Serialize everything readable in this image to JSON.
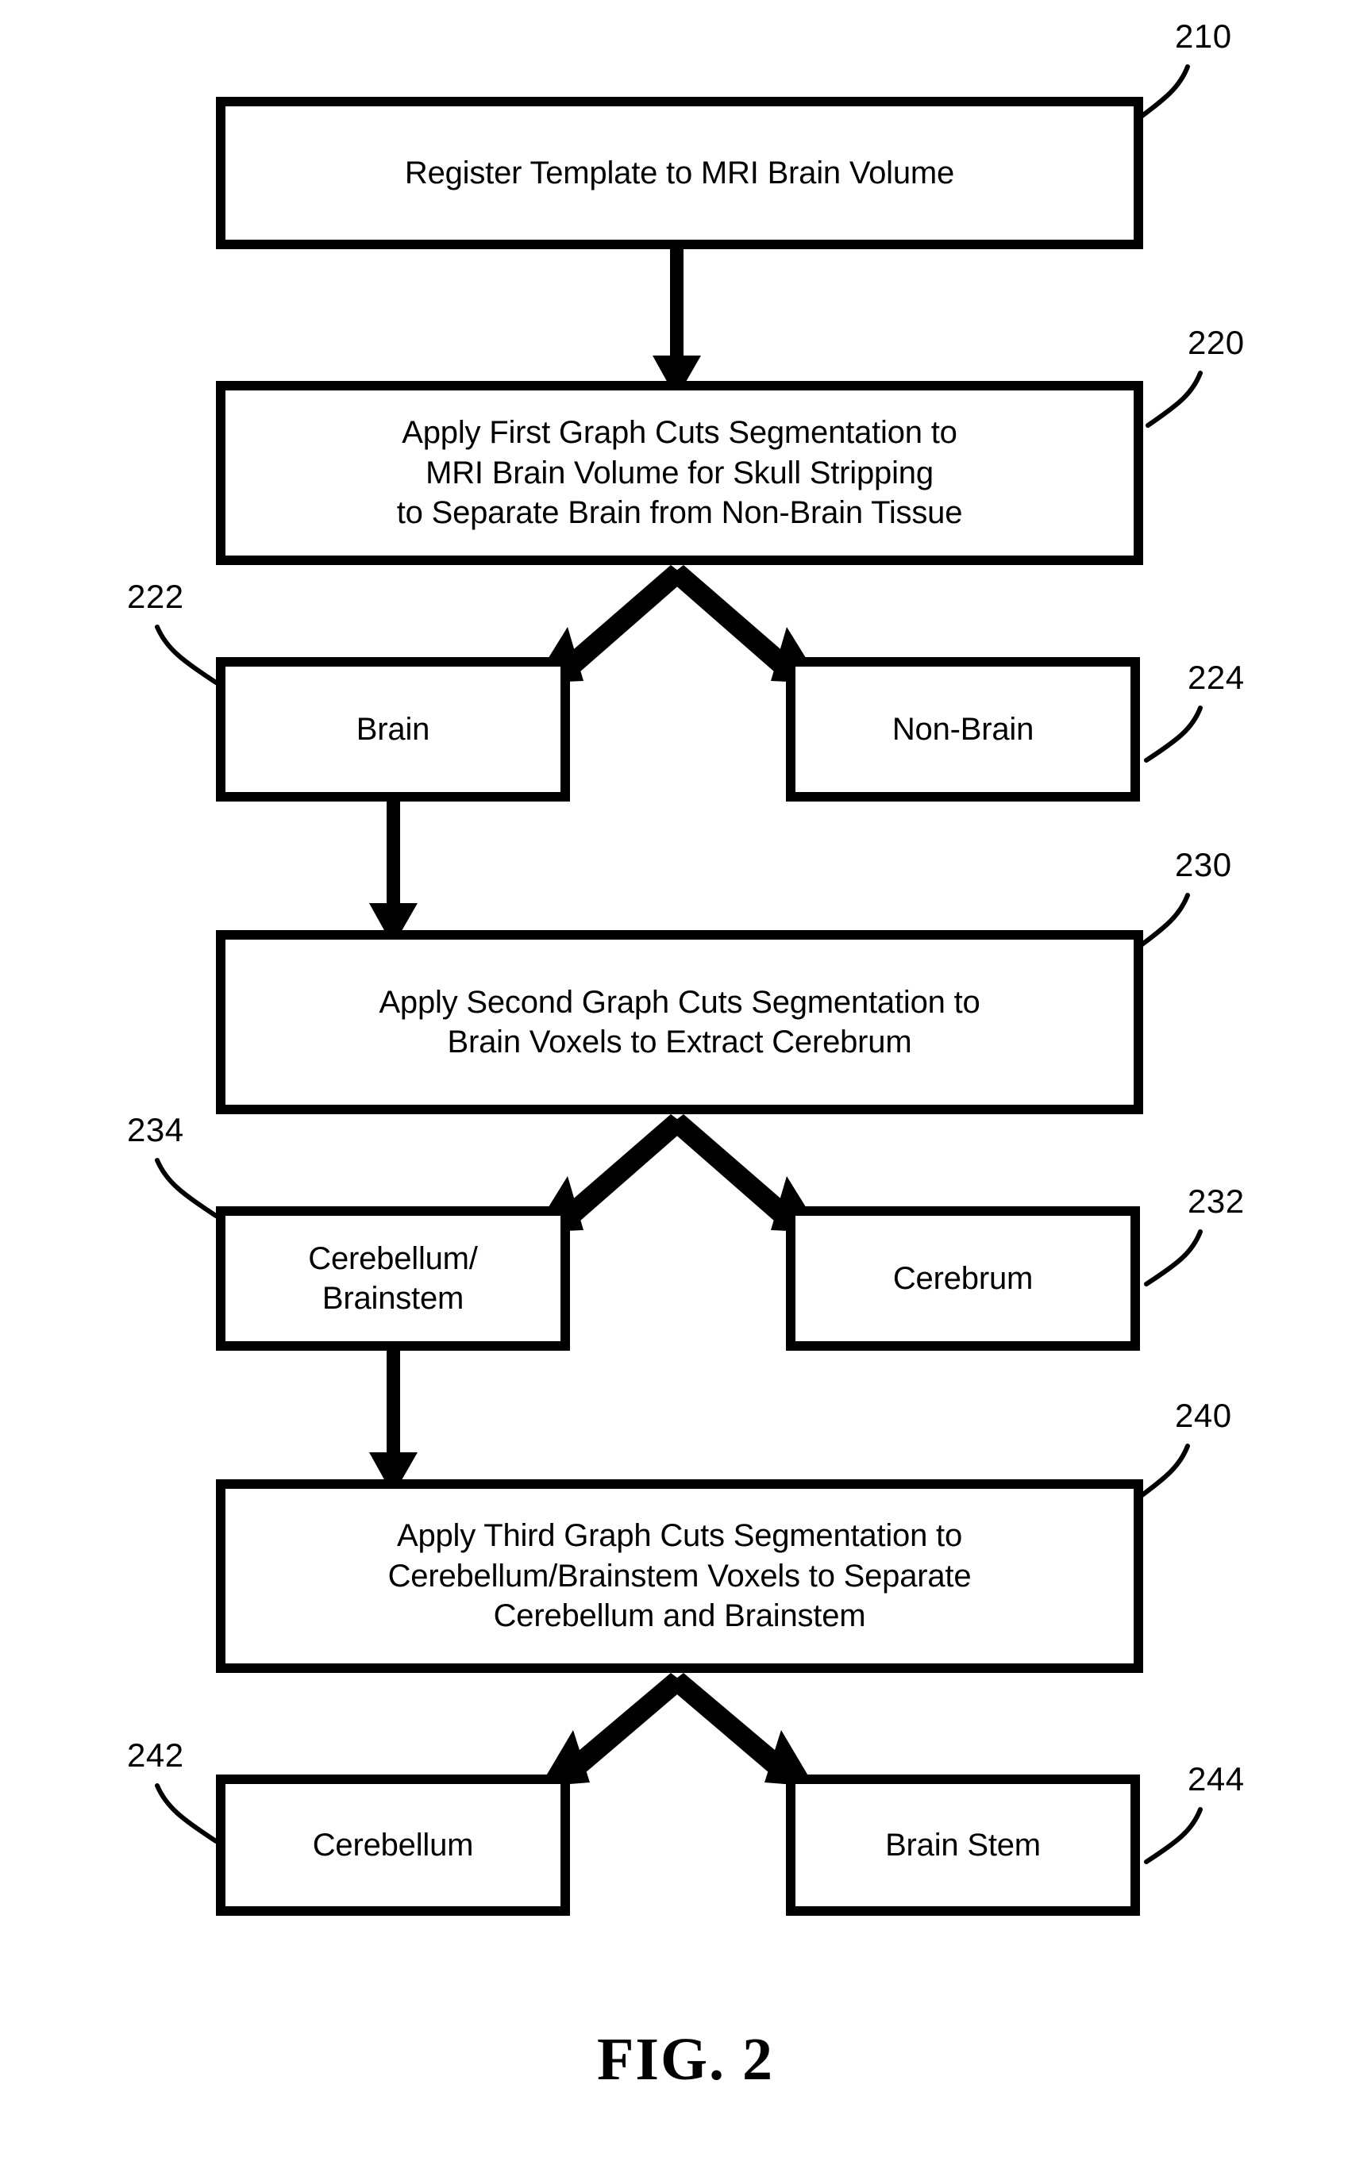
{
  "figure": {
    "caption": "FIG. 2",
    "type": "patent-flowchart"
  },
  "nodes": [
    {
      "id": "210",
      "ref": "210",
      "kind": "process",
      "label": "Register Template to MRI Brain Volume"
    },
    {
      "id": "220",
      "ref": "220",
      "kind": "process",
      "label": "Apply First Graph Cuts Segmentation to\nMRI Brain Volume for Skull Stripping\nto Separate Brain from Non-Brain Tissue"
    },
    {
      "id": "222",
      "ref": "222",
      "kind": "result",
      "label": "Brain"
    },
    {
      "id": "224",
      "ref": "224",
      "kind": "result",
      "label": "Non-Brain"
    },
    {
      "id": "230",
      "ref": "230",
      "kind": "process",
      "label": "Apply Second Graph Cuts Segmentation to\nBrain Voxels to Extract Cerebrum"
    },
    {
      "id": "234",
      "ref": "234",
      "kind": "result",
      "label": "Cerebellum/\nBrainstem"
    },
    {
      "id": "232",
      "ref": "232",
      "kind": "result",
      "label": "Cerebrum"
    },
    {
      "id": "240",
      "ref": "240",
      "kind": "process",
      "label": "Apply Third Graph Cuts Segmentation to\nCerebellum/Brainstem Voxels to Separate\nCerebellum and Brainstem"
    },
    {
      "id": "242",
      "ref": "242",
      "kind": "result",
      "label": "Cerebellum"
    },
    {
      "id": "244",
      "ref": "244",
      "kind": "result",
      "label": "Brain Stem"
    }
  ],
  "flow": {
    "edges": [
      {
        "from": "210",
        "to": "220",
        "style": "straight-down"
      },
      {
        "from": "220",
        "to": "222",
        "style": "branch-left"
      },
      {
        "from": "220",
        "to": "224",
        "style": "branch-right"
      },
      {
        "from": "222",
        "to": "230",
        "style": "straight-down"
      },
      {
        "from": "230",
        "to": "234",
        "style": "branch-left"
      },
      {
        "from": "230",
        "to": "232",
        "style": "branch-right"
      },
      {
        "from": "234",
        "to": "240",
        "style": "straight-down"
      },
      {
        "from": "240",
        "to": "242",
        "style": "branch-left"
      },
      {
        "from": "240",
        "to": "244",
        "style": "branch-right"
      }
    ]
  },
  "colors": {
    "ink": "#000000",
    "paper": "#ffffff"
  }
}
